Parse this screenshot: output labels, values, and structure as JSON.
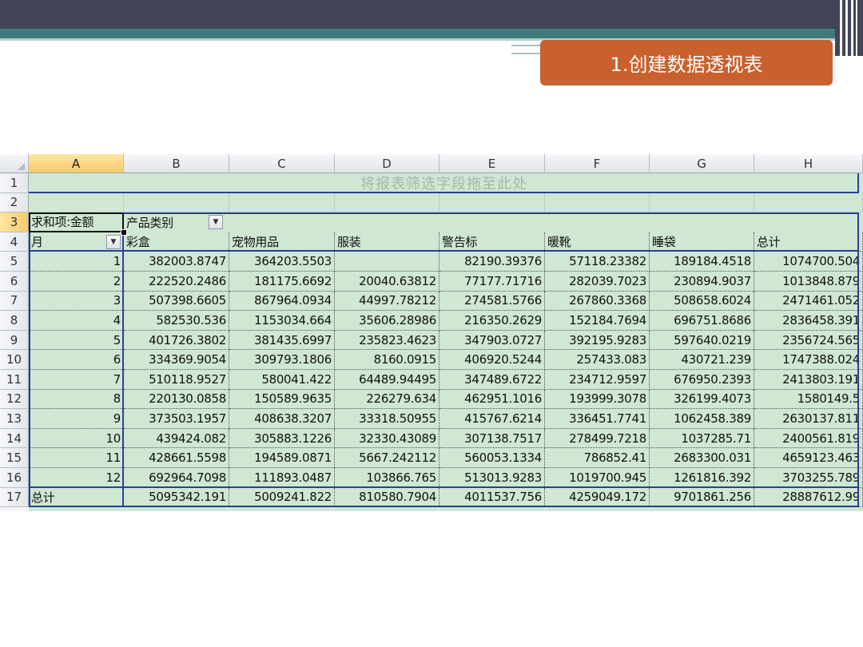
{
  "slide": {
    "title": "1.创建数据透视表"
  },
  "sheet": {
    "columns": [
      "A",
      "B",
      "C",
      "D",
      "E",
      "F",
      "G",
      "H"
    ],
    "rows": [
      "1",
      "2",
      "3",
      "4",
      "5",
      "6",
      "7",
      "8",
      "9",
      "10",
      "11",
      "12",
      "13",
      "14",
      "15",
      "16",
      "17"
    ],
    "drop_hint": "将报表筛选字段拖至此处",
    "value_field": "求和项:金额",
    "column_field": "产品类别",
    "row_field": "月",
    "headers": [
      "彩盒",
      "宠物用品",
      "服装",
      "警告标",
      "暖靴",
      "睡袋",
      "总计"
    ],
    "data": [
      [
        "1",
        "382003.8747",
        "364203.5503",
        "",
        "82190.39376",
        "57118.23382",
        "189184.4518",
        "1074700.504"
      ],
      [
        "2",
        "222520.2486",
        "181175.6692",
        "20040.63812",
        "77177.71716",
        "282039.7023",
        "230894.9037",
        "1013848.879"
      ],
      [
        "3",
        "507398.6605",
        "867964.0934",
        "44997.78212",
        "274581.5766",
        "267860.3368",
        "508658.6024",
        "2471461.052"
      ],
      [
        "4",
        "582530.536",
        "1153034.664",
        "35606.28986",
        "216350.2629",
        "152184.7694",
        "696751.8686",
        "2836458.391"
      ],
      [
        "5",
        "401726.3802",
        "381435.6997",
        "235823.4623",
        "347903.0727",
        "392195.9283",
        "597640.0219",
        "2356724.565"
      ],
      [
        "6",
        "334369.9054",
        "309793.1806",
        "8160.0915",
        "406920.5244",
        "257433.083",
        "430721.239",
        "1747388.024"
      ],
      [
        "7",
        "510118.9527",
        "580041.422",
        "64489.94495",
        "347489.6722",
        "234712.9597",
        "676950.2393",
        "2413803.191"
      ],
      [
        "8",
        "220130.0858",
        "150589.9635",
        "226279.634",
        "462951.1016",
        "193999.3078",
        "326199.4073",
        "1580149.5"
      ],
      [
        "9",
        "373503.1957",
        "408638.3207",
        "33318.50955",
        "415767.6214",
        "336451.7741",
        "1062458.389",
        "2630137.811"
      ],
      [
        "10",
        "439424.082",
        "305883.1226",
        "32330.43089",
        "307138.7517",
        "278499.7218",
        "1037285.71",
        "2400561.819"
      ],
      [
        "11",
        "428661.5598",
        "194589.0871",
        "5667.242112",
        "560053.1334",
        "786852.41",
        "2683300.031",
        "4659123.463"
      ],
      [
        "12",
        "692964.7098",
        "111893.0487",
        "103866.765",
        "513013.9283",
        "1019700.945",
        "1261816.392",
        "3703255.789"
      ]
    ],
    "total_label": "总计",
    "totals": [
      "5095342.191",
      "5009241.822",
      "810580.7904",
      "4011537.756",
      "4259049.172",
      "9701861.256",
      "28887612.99"
    ],
    "dropdown_glyph": "▼"
  }
}
